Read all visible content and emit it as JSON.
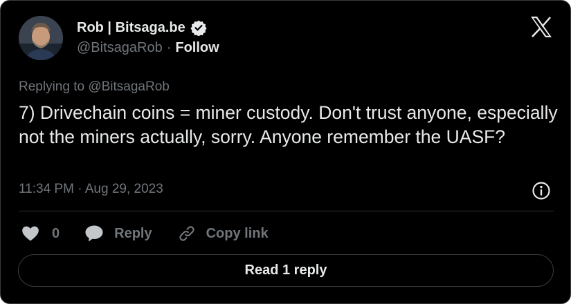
{
  "author": {
    "display_name": "Rob | Bitsaga.be",
    "handle": "@BitsagaRob",
    "separator": "·",
    "follow_label": "Follow",
    "verified": true
  },
  "tweet": {
    "reply_context": "Replying to @BitsagaRob",
    "text": "7) Drivechain coins = miner custody. Don't trust anyone, especially not the miners actually, sorry. Anyone remember the UASF?",
    "timestamp": "11:34 PM · Aug 29, 2023"
  },
  "actions": {
    "like_count": "0",
    "reply_label": "Reply",
    "copy_link_label": "Copy link"
  },
  "read_replies_label": "Read 1 reply",
  "icons": {
    "avatar": "avatar-photo",
    "verified": "verified-badge-icon",
    "brand": "x-logo-icon",
    "info": "info-icon",
    "like": "heart-icon",
    "reply": "speech-bubble-icon",
    "copy_link": "link-icon"
  },
  "colors": {
    "background": "#000000",
    "primary_text": "#e7e9ea",
    "secondary_text": "#71767b",
    "border": "#2f3336"
  }
}
